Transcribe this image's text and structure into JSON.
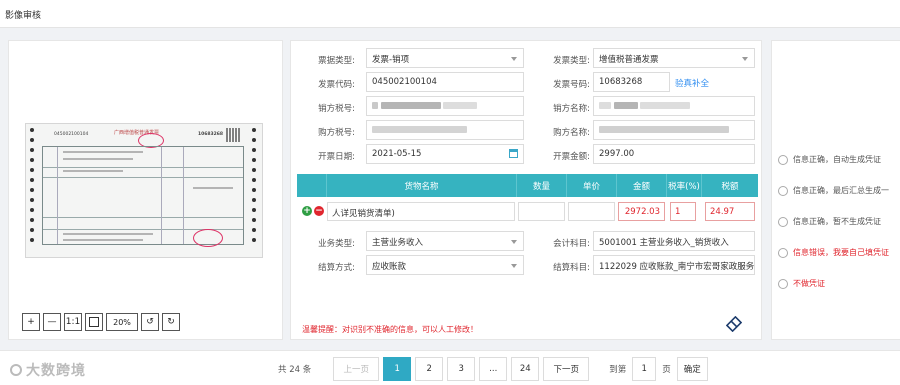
{
  "page_title": "影像审核",
  "image_toolbar": {
    "zoom_in": "+",
    "zoom_out": "—",
    "actual_size": "1:1",
    "zoom_level": "20%",
    "rotate_left": "↺",
    "rotate_right": "↻"
  },
  "form": {
    "invoice_category_label": "票据类型:",
    "invoice_category_value": "发票-销项",
    "invoice_type_label": "发票类型:",
    "invoice_type_value": "增值税普通发票",
    "invoice_code_label": "发票代码:",
    "invoice_code_value": "045002100104",
    "invoice_number_label": "发票号码:",
    "invoice_number_value": "10683268",
    "verify_link": "验真补全",
    "seller_tax_label": "销方税号:",
    "seller_name_label": "销方名称:",
    "buyer_tax_label": "购方税号:",
    "buyer_name_label": "购方名称:",
    "issue_date_label": "开票日期:",
    "issue_date_value": "2021-05-15",
    "amount_label": "开票金额:",
    "amount_value": "2997.00",
    "business_type_label": "业务类型:",
    "business_type_value": "主营业务收入",
    "account_label": "会计科目:",
    "account_value": "5001001 主营业务收入_销货收入",
    "settlement_label": "结算方式:",
    "settlement_value": "应收账款",
    "settle_account_label": "结算科目:",
    "settle_account_value": "1122029 应收账款_南宁市宏哥家政服务"
  },
  "table": {
    "headers": [
      "货物名称",
      "数量",
      "单价",
      "金额",
      "税率(%)",
      "税额"
    ],
    "row": {
      "name": "人详见销货清单)",
      "qty": "",
      "price": "",
      "amount": "2972.03",
      "rate": "1",
      "tax": "24.97"
    }
  },
  "notice": "温馨提醒：对识别不准确的信息，可以人工修改！",
  "options": [
    "信息正确，自动生成凭证",
    "信息正确，最后汇总生成一",
    "信息正确，暂不生成凭证",
    "信息错误，我要自己填凭证",
    "不做凭证"
  ],
  "invoice_image": {
    "code": "045002100104",
    "number": "10683268",
    "title": "广西增值税普通发票"
  },
  "pagination": {
    "total": "共 24 条",
    "prev": "上一页",
    "pages": [
      "1",
      "2",
      "3",
      "...",
      "24"
    ],
    "active_page": "1",
    "next": "下一页",
    "goto_prefix": "到第",
    "goto_value": "1",
    "goto_suffix": "页",
    "confirm": "确定"
  },
  "watermark": "大数跨境",
  "colors": {
    "accent": "#36b3c0",
    "active_page": "#2fa9c4",
    "error": "#e0262e",
    "link": "#2d8cf0"
  }
}
